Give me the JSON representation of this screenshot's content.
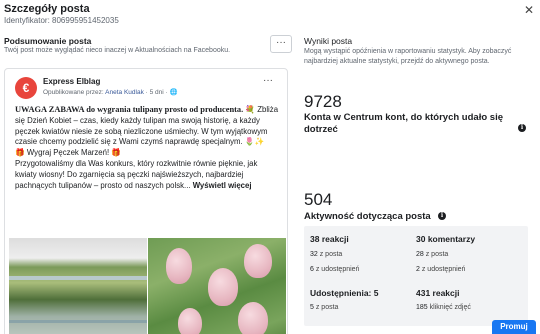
{
  "header": {
    "title": "Szczegóły posta",
    "id_line": "Identyfikator: 806995951452035",
    "close_icon": "close-icon"
  },
  "summary": {
    "title": "Podsumowanie posta",
    "subtitle": "Twój post może wyglądać nieco inaczej w Aktualnościach na Facebooku.",
    "more_label": "···"
  },
  "post": {
    "avatar_letter": "€",
    "page_name": "Express Elblag",
    "published_by_prefix": "Opublikowane przez: ",
    "author": "Aneta Kudlak",
    "time": " · 5 dni · ",
    "globe_icon": "globe-icon",
    "dots": "···",
    "text_bold": "UWAGA ZABAWA do wygrania tulipany prosto od producenta.",
    "text_line1": " 💐 Zbliża się Dzień Kobiet – czas, kiedy każdy tulipan ma swoją historię, a każdy pęczek kwiatów niesie ze sobą niezliczone uśmiechy. W tym wyjątkowym czasie chcemy podzielić się z Wami czymś naprawdę specjalnym. 🌷✨",
    "text_line2": "🎁 Wygraj Pęczek Marzeń! 🎁",
    "text_line3": "Przygotowaliśmy dla Was konkurs, który rozkwitnie równie pięknie, jak kwiaty wiosny! Do zgarnięcia są pęczki najświeższych, najbardziej pachnących tulipanów – prosto od naszych polsk...",
    "see_more": " Wyświetl więcej"
  },
  "results": {
    "title": "Wyniki posta",
    "subtitle": "Mogą wystąpić opóźnienia w raportowaniu statystyk. Aby zobaczyć najbardziej aktualne statystyki, przejdź do aktywnego posta.",
    "reach_value": "9728",
    "reach_label": "Konta w Centrum kont, do których udało się dotrzeć",
    "engagement_value": "504",
    "engagement_label": "Aktywność dotycząca posta",
    "reactions": "38 reakcji",
    "reactions_post_n": "32",
    "reactions_post": " z posta",
    "reactions_share_n": "6",
    "reactions_share": " z udostępnień",
    "comments": "30 komentarzy",
    "comments_post_n": "28",
    "comments_post": " z posta",
    "comments_share_n": "2",
    "comments_share": " z udostępnień",
    "shares": "Udostępnienia: 5",
    "shares_post_n": "5",
    "shares_post": " z posta",
    "clicks": "431 reakcji",
    "clicks_photo_n": "185",
    "clicks_photo": " kliknięć zdjęć"
  },
  "footer": {
    "promote": "Promuj"
  },
  "colors": {
    "accent": "#1877f2",
    "avatar": "#e8453c"
  }
}
